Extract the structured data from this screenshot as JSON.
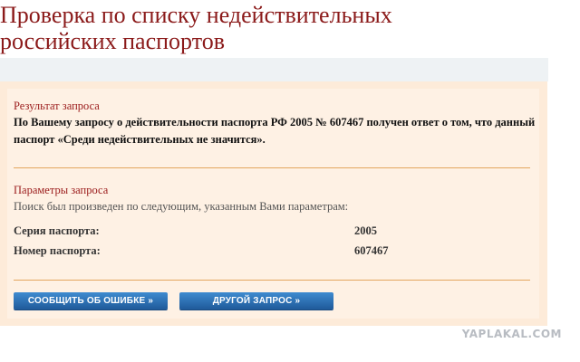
{
  "page": {
    "title_line1": "Проверка по списку недействительных",
    "title_line2": "российских паспортов"
  },
  "result": {
    "heading": "Результат запроса",
    "text": "По Вашему запросу о действительности паспорта РФ 2005 № 607467 получен ответ о том, что данный паспорт «Среди недействительных не значится»."
  },
  "params": {
    "heading": "Параметры запроса",
    "intro": "Поиск был произведен по следующим, указанным Вами параметрам:",
    "rows": [
      {
        "label": "Серия паспорта:",
        "value": "2005"
      },
      {
        "label": "Номер паспорта:",
        "value": "607467"
      }
    ]
  },
  "actions": {
    "report_error": "СООБЩИТЬ ОБ ОШИБКЕ »",
    "new_query": "ДРУГОЙ ЗАПРОС »"
  },
  "watermark": "YAPLAKAL.COM",
  "colors": {
    "title": "#8b1a1a",
    "heading": "#9b1c1c",
    "panel_bg": "#fef1e4",
    "divider": "#e3a65f",
    "button": "#2a6fb5"
  }
}
